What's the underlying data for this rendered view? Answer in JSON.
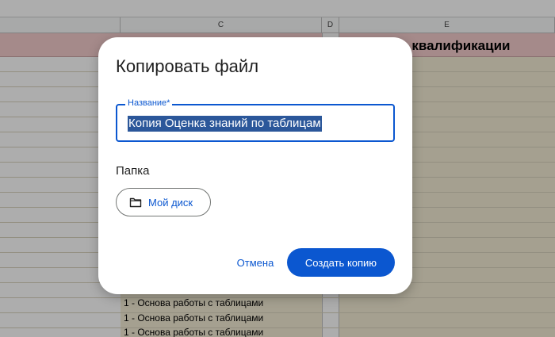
{
  "sheet": {
    "columns": [
      {
        "letter": ""
      },
      {
        "letter": "C"
      },
      {
        "letter": "D"
      },
      {
        "letter": "E"
      }
    ],
    "header_row_title": "ень квалификации",
    "rows": [
      "1 - Основа работы с таблицами",
      "1 - Основа работы с таблицами",
      "1 - Основа работы с таблицами"
    ]
  },
  "dialog": {
    "title": "Копировать файл",
    "name_field": {
      "label": "Название*",
      "value": "Копия Оценка знаний по таблицам"
    },
    "folder": {
      "label": "Папка",
      "button_label": "Мой диск",
      "icon": "folder-icon"
    },
    "cancel_label": "Отмена",
    "confirm_label": "Создать копию"
  },
  "colors": {
    "accent": "#0b57d0",
    "header_row": "#f4cccc",
    "cell_fill": "#f3ecd5",
    "selection": "#2b579a"
  }
}
